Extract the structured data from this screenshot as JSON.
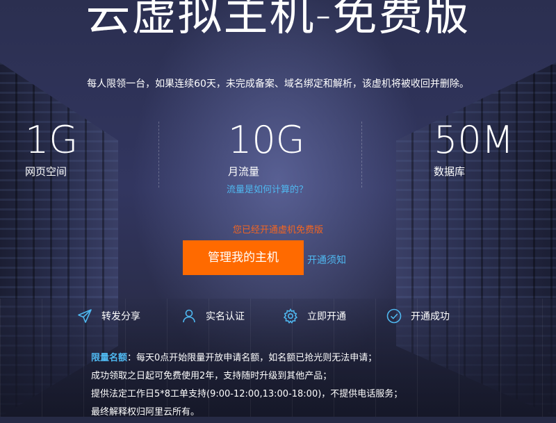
{
  "header": {
    "title": "云虚拟主机-免费版",
    "notice": "每人限领一台，如果连续60天，未完成备案、域名绑定和解析，该虚机将被收回并删除。"
  },
  "stats": [
    {
      "value": "1G",
      "label": "网页空间"
    },
    {
      "value": "10G",
      "label": "月流量"
    },
    {
      "value": "50M",
      "label": "数据库"
    }
  ],
  "traffic_link": "流量是如何计算的？",
  "status_text": "您已经开通虚机免费版",
  "manage_button": "管理我的主机",
  "notice_link": "开通须知",
  "steps": [
    {
      "icon": "send-icon",
      "label": "转发分享"
    },
    {
      "icon": "user-icon",
      "label": "实名认证"
    },
    {
      "icon": "gear-icon",
      "label": "立即开通"
    },
    {
      "icon": "check-circle-icon",
      "label": "开通成功"
    }
  ],
  "rules": {
    "highlight": "限量名额",
    "line1": "：每天0点开始限量开放申请名额，如名额已抢光则无法申请；",
    "line2": "成功领取之日起可免费使用2年，支持随时升级到其他产品；",
    "line3": "提供法定工作日5*8工单支持(9:00-12:00,13:00-18:00)，不提供电话服务；",
    "line4": "最终解释权归阿里云所有。"
  },
  "colors": {
    "accent_orange": "#ff6a00",
    "link_blue": "#4fb8f0",
    "status_orange": "#f26522",
    "background": "#2b2f50"
  }
}
